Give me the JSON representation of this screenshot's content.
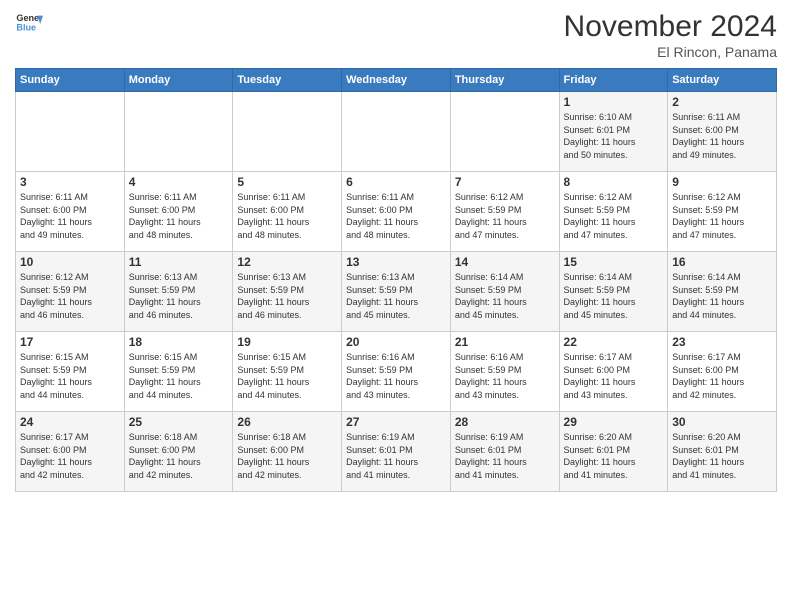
{
  "header": {
    "logo_general": "General",
    "logo_blue": "Blue",
    "month": "November 2024",
    "location": "El Rincon, Panama"
  },
  "days_of_week": [
    "Sunday",
    "Monday",
    "Tuesday",
    "Wednesday",
    "Thursday",
    "Friday",
    "Saturday"
  ],
  "weeks": [
    [
      {
        "day": "",
        "info": ""
      },
      {
        "day": "",
        "info": ""
      },
      {
        "day": "",
        "info": ""
      },
      {
        "day": "",
        "info": ""
      },
      {
        "day": "",
        "info": ""
      },
      {
        "day": "1",
        "info": "Sunrise: 6:10 AM\nSunset: 6:01 PM\nDaylight: 11 hours\nand 50 minutes."
      },
      {
        "day": "2",
        "info": "Sunrise: 6:11 AM\nSunset: 6:00 PM\nDaylight: 11 hours\nand 49 minutes."
      }
    ],
    [
      {
        "day": "3",
        "info": "Sunrise: 6:11 AM\nSunset: 6:00 PM\nDaylight: 11 hours\nand 49 minutes."
      },
      {
        "day": "4",
        "info": "Sunrise: 6:11 AM\nSunset: 6:00 PM\nDaylight: 11 hours\nand 48 minutes."
      },
      {
        "day": "5",
        "info": "Sunrise: 6:11 AM\nSunset: 6:00 PM\nDaylight: 11 hours\nand 48 minutes."
      },
      {
        "day": "6",
        "info": "Sunrise: 6:11 AM\nSunset: 6:00 PM\nDaylight: 11 hours\nand 48 minutes."
      },
      {
        "day": "7",
        "info": "Sunrise: 6:12 AM\nSunset: 5:59 PM\nDaylight: 11 hours\nand 47 minutes."
      },
      {
        "day": "8",
        "info": "Sunrise: 6:12 AM\nSunset: 5:59 PM\nDaylight: 11 hours\nand 47 minutes."
      },
      {
        "day": "9",
        "info": "Sunrise: 6:12 AM\nSunset: 5:59 PM\nDaylight: 11 hours\nand 47 minutes."
      }
    ],
    [
      {
        "day": "10",
        "info": "Sunrise: 6:12 AM\nSunset: 5:59 PM\nDaylight: 11 hours\nand 46 minutes."
      },
      {
        "day": "11",
        "info": "Sunrise: 6:13 AM\nSunset: 5:59 PM\nDaylight: 11 hours\nand 46 minutes."
      },
      {
        "day": "12",
        "info": "Sunrise: 6:13 AM\nSunset: 5:59 PM\nDaylight: 11 hours\nand 46 minutes."
      },
      {
        "day": "13",
        "info": "Sunrise: 6:13 AM\nSunset: 5:59 PM\nDaylight: 11 hours\nand 45 minutes."
      },
      {
        "day": "14",
        "info": "Sunrise: 6:14 AM\nSunset: 5:59 PM\nDaylight: 11 hours\nand 45 minutes."
      },
      {
        "day": "15",
        "info": "Sunrise: 6:14 AM\nSunset: 5:59 PM\nDaylight: 11 hours\nand 45 minutes."
      },
      {
        "day": "16",
        "info": "Sunrise: 6:14 AM\nSunset: 5:59 PM\nDaylight: 11 hours\nand 44 minutes."
      }
    ],
    [
      {
        "day": "17",
        "info": "Sunrise: 6:15 AM\nSunset: 5:59 PM\nDaylight: 11 hours\nand 44 minutes."
      },
      {
        "day": "18",
        "info": "Sunrise: 6:15 AM\nSunset: 5:59 PM\nDaylight: 11 hours\nand 44 minutes."
      },
      {
        "day": "19",
        "info": "Sunrise: 6:15 AM\nSunset: 5:59 PM\nDaylight: 11 hours\nand 44 minutes."
      },
      {
        "day": "20",
        "info": "Sunrise: 6:16 AM\nSunset: 5:59 PM\nDaylight: 11 hours\nand 43 minutes."
      },
      {
        "day": "21",
        "info": "Sunrise: 6:16 AM\nSunset: 5:59 PM\nDaylight: 11 hours\nand 43 minutes."
      },
      {
        "day": "22",
        "info": "Sunrise: 6:17 AM\nSunset: 6:00 PM\nDaylight: 11 hours\nand 43 minutes."
      },
      {
        "day": "23",
        "info": "Sunrise: 6:17 AM\nSunset: 6:00 PM\nDaylight: 11 hours\nand 42 minutes."
      }
    ],
    [
      {
        "day": "24",
        "info": "Sunrise: 6:17 AM\nSunset: 6:00 PM\nDaylight: 11 hours\nand 42 minutes."
      },
      {
        "day": "25",
        "info": "Sunrise: 6:18 AM\nSunset: 6:00 PM\nDaylight: 11 hours\nand 42 minutes."
      },
      {
        "day": "26",
        "info": "Sunrise: 6:18 AM\nSunset: 6:00 PM\nDaylight: 11 hours\nand 42 minutes."
      },
      {
        "day": "27",
        "info": "Sunrise: 6:19 AM\nSunset: 6:01 PM\nDaylight: 11 hours\nand 41 minutes."
      },
      {
        "day": "28",
        "info": "Sunrise: 6:19 AM\nSunset: 6:01 PM\nDaylight: 11 hours\nand 41 minutes."
      },
      {
        "day": "29",
        "info": "Sunrise: 6:20 AM\nSunset: 6:01 PM\nDaylight: 11 hours\nand 41 minutes."
      },
      {
        "day": "30",
        "info": "Sunrise: 6:20 AM\nSunset: 6:01 PM\nDaylight: 11 hours\nand 41 minutes."
      }
    ]
  ]
}
